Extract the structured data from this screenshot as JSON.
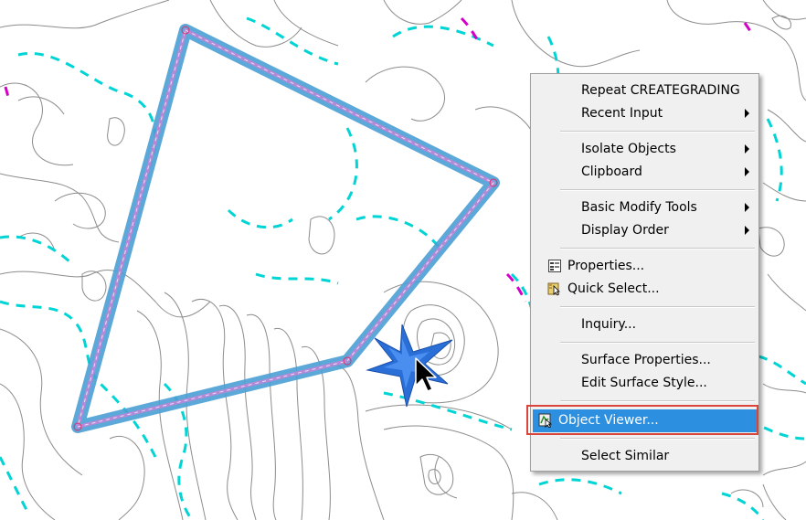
{
  "menu": {
    "repeat": "Repeat CREATEGRADING",
    "recent_input": "Recent Input",
    "isolate_objects": "Isolate Objects",
    "clipboard": "Clipboard",
    "basic_modify_tools": "Basic Modify Tools",
    "display_order": "Display Order",
    "properties": "Properties...",
    "quick_select": "Quick Select...",
    "inquiry": "Inquiry...",
    "surface_properties": "Surface Properties...",
    "edit_surface_style": "Edit Surface Style...",
    "object_viewer": "Object Viewer...",
    "select_similar": "Select Similar"
  },
  "icons": {
    "properties": "properties-icon",
    "quick_select": "quick-select-icon",
    "object_viewer": "object-viewer-icon",
    "cursor": "arrow-cursor-icon"
  },
  "colors": {
    "selection_outline": "#4a9fd4",
    "selection_core": "#b48ad8",
    "contour_major": "#00d4d4",
    "contour_minor": "#8c8c8c",
    "accent_magenta": "#d400c8",
    "menu_highlight": "#2d8fe0",
    "callout_border": "#d9453a",
    "starburst": "#2a6fd8"
  }
}
